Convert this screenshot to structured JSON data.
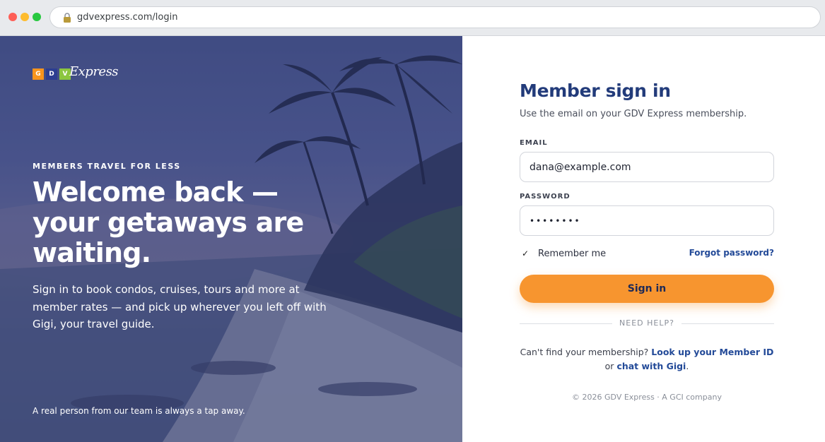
{
  "browser": {
    "url": "gdvexpress.com/login"
  },
  "hero": {
    "logo": {
      "g": "G",
      "d": "D",
      "v": "V",
      "wordmark": "Express"
    },
    "eyebrow": "MEMBERS TRAVEL FOR LESS",
    "headline": "Welcome back — your getaways are waiting.",
    "lede": "Sign in to book condos, cruises, tours and more at member rates — and pick up wherever you left off with Gigi, your travel guide.",
    "footnote": "A real person from our team is always a tap away."
  },
  "form": {
    "title": "Member sign in",
    "subtitle": "Use the email on your GDV Express membership.",
    "email_label": "EMAIL",
    "email_value": "dana@example.com",
    "password_label": "PASSWORD",
    "password_value": "••••••••",
    "remember_checked": true,
    "remember_label": "Remember me",
    "forgot_label": "Forgot password?",
    "signin_label": "Sign in",
    "divider_label": "NEED HELP?",
    "help_prefix": "Can't find your membership?",
    "help_link1": "Look up your Member ID",
    "help_or": "or",
    "help_link2": "chat with Gigi",
    "help_suffix": ".",
    "copyright": "© 2026 GDV Express · A GCI company"
  },
  "colors": {
    "brand_navy": "#223b7a",
    "accent_orange": "#f7952f",
    "link_blue": "#234a98",
    "logo_orange": "#f7941d",
    "logo_blue": "#2c3e91",
    "logo_green": "#8cc63f"
  }
}
